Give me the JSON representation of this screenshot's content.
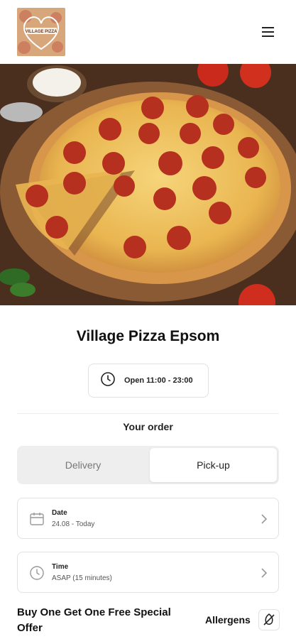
{
  "header": {
    "logo_text": "VILLAGE PIZZA",
    "menu_icon": "hamburger-menu-icon"
  },
  "hero": {
    "image": "pepperoni-pizza-photo"
  },
  "restaurant": {
    "name": "Village Pizza Epsom",
    "hours": "Open 11:00 - 23:00"
  },
  "order": {
    "heading": "Your order",
    "tabs": [
      {
        "label": "Delivery",
        "selected": false
      },
      {
        "label": "Pick-up",
        "selected": true
      }
    ],
    "date": {
      "label": "Date",
      "value": "24.08 - Today",
      "icon": "calendar-icon"
    },
    "time": {
      "label": "Time",
      "value": "ASAP (15 minutes)",
      "icon": "clock-icon"
    }
  },
  "menu": {
    "section_title": "Buy One Get One Free Special Offer",
    "allergens_label": "Allergens",
    "allergens_icon": "allergen-icon"
  },
  "colors": {
    "accent": "#111111",
    "tab_track": "#eeeeee",
    "border": "#e2e2e2"
  }
}
